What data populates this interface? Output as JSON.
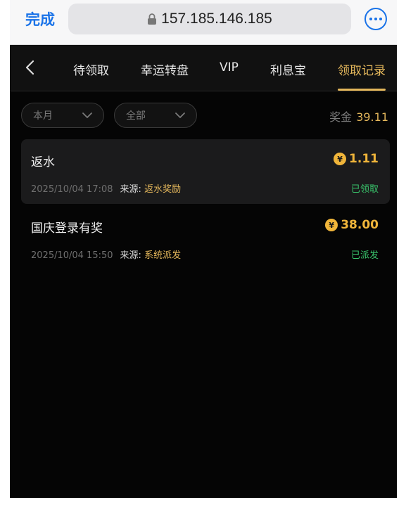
{
  "browser": {
    "done_label": "完成",
    "url": "157.185.146.185"
  },
  "nav": {
    "tabs": [
      {
        "label": "待领取"
      },
      {
        "label": "幸运转盘"
      },
      {
        "label": "VIP"
      },
      {
        "label": "利息宝"
      },
      {
        "label": "领取记录"
      }
    ],
    "active_tab": "领取记录"
  },
  "filters": {
    "period": "本月",
    "category": "全部"
  },
  "bonus": {
    "label": "奖金",
    "value": "39.11"
  },
  "records": [
    {
      "title": "返水",
      "amount": "1.11",
      "datetime": "2025/10/04 17:08",
      "source_label": "来源:",
      "source": "返水奖励",
      "status": "已领取"
    },
    {
      "title": "国庆登录有奖",
      "amount": "38.00",
      "datetime": "2025/10/04 15:50",
      "source_label": "来源:",
      "source": "系统派发",
      "status": "已派发"
    }
  ],
  "currency_symbol": "¥",
  "colors": {
    "accent": "#e5b85c",
    "coin": "#f0b53a",
    "status_green": "#39c46b",
    "safari_blue": "#1a73e8",
    "background": "#050505"
  }
}
